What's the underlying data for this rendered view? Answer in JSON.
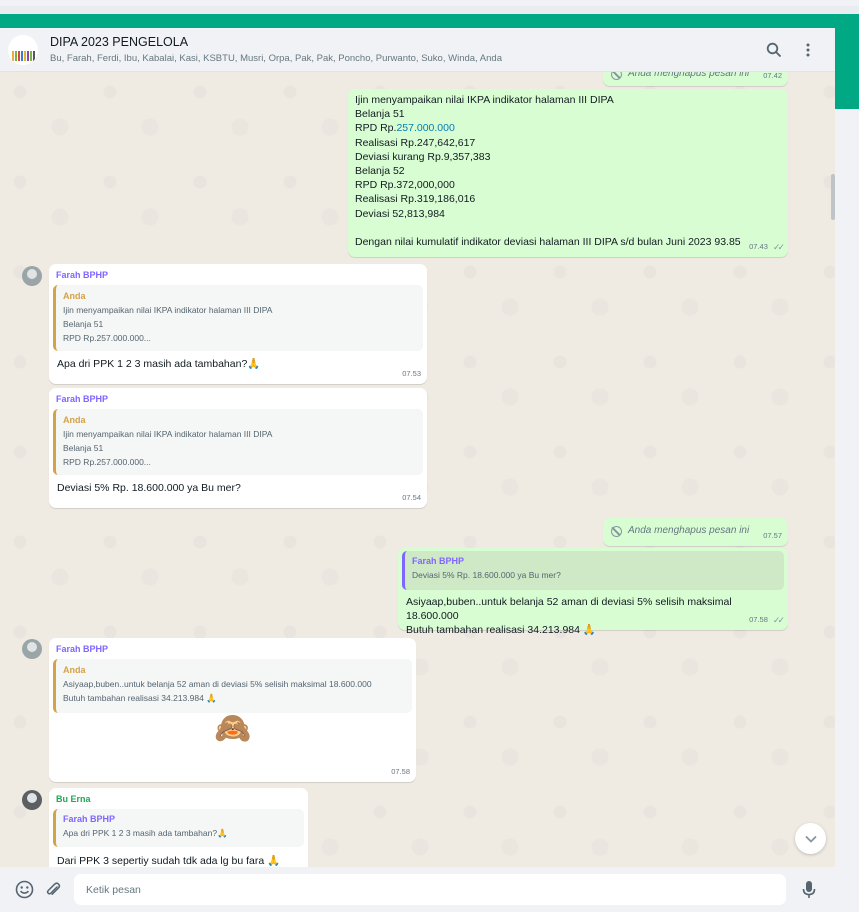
{
  "header": {
    "title": "DIPA 2023 PENGELOLA",
    "participants": "Bu, Farah, Ferdi, Ibu, Kabalai, Kasi, KSBTU, Musri, Orpa, Pak, Pak, Poncho, Purwanto, Suko, Winda, Anda",
    "search_icon": "search-icon",
    "menu_icon": "kebab-menu-icon"
  },
  "messages": {
    "m0": {
      "deleted_text": "Anda menghapus pesan ini",
      "time": "07.42"
    },
    "m1": {
      "lines": [
        "Ijin menyampaikan nilai IKPA indikator halaman III DIPA",
        "Belanja 51"
      ],
      "rpd_prefix": "RPD Rp.",
      "rpd_link": "257.000.000",
      "lines2": [
        "Realisasi Rp.247,642,617",
        "Deviasi kurang Rp.9,357,383",
        "Belanja 52",
        "RPD Rp.372,000,000",
        "Realisasi Rp.319,186,016",
        "Deviasi 52,813,984"
      ],
      "closing": "Dengan nilai kumulatif indikator deviasi halaman III DIPA s/d bulan Juni 2023 93.85",
      "time": "07.43"
    },
    "m2": {
      "sender": "Farah BPHP",
      "quote_name": "Anda",
      "quote_lines": [
        "Ijin menyampaikan nilai IKPA indikator halaman III DIPA",
        "Belanja 51",
        "RPD Rp.257.000.000..."
      ],
      "text": "Apa dri PPK 1 2 3 masih ada tambahan?🙏",
      "time": "07.53"
    },
    "m3": {
      "sender": "Farah BPHP",
      "quote_name": "Anda",
      "quote_lines": [
        "Ijin menyampaikan nilai IKPA indikator halaman III DIPA",
        "Belanja 51",
        "RPD Rp.257.000.000..."
      ],
      "text": "Deviasi 5% Rp. 18.600.000 ya Bu mer?",
      "time": "07.54"
    },
    "m4": {
      "deleted_text": "Anda menghapus pesan ini",
      "time": "07.57"
    },
    "m5": {
      "quote_name": "Farah BPHP",
      "quote_text": "Deviasi 5% Rp. 18.600.000 ya Bu mer?",
      "lines": [
        "Asiyaap,buben..untuk belanja 52 aman di deviasi 5% selisih maksimal 18.600.000",
        "Butuh tambahan realisasi 34.213.984 🙏"
      ],
      "time": "07.58"
    },
    "m6": {
      "sender": "Farah BPHP",
      "quote_name": "Anda",
      "quote_lines": [
        "Asiyaap,buben..untuk belanja 52 aman di deviasi 5% selisih maksimal 18.600.000",
        "Butuh tambahan realisasi 34.213.984 🙏"
      ],
      "sticker": "🙈",
      "time": "07.58"
    },
    "m7": {
      "sender": "Bu Erna",
      "quote_name": "Farah BPHP",
      "quote_text": "Apa dri PPK 1 2 3 masih ada tambahan?🙏",
      "text": "Dari PPK 3 sepertiy sudah tdk ada lg bu fara 🙏"
    }
  },
  "footer": {
    "placeholder": "Ketik pesan",
    "emoji_icon": "emoji-icon",
    "attach_icon": "paperclip-icon",
    "mic_icon": "microphone-icon"
  },
  "colors": {
    "accent": "#00a884",
    "outgoing": "#d9fdd3",
    "incoming": "#ffffff",
    "link": "#027eb5"
  }
}
